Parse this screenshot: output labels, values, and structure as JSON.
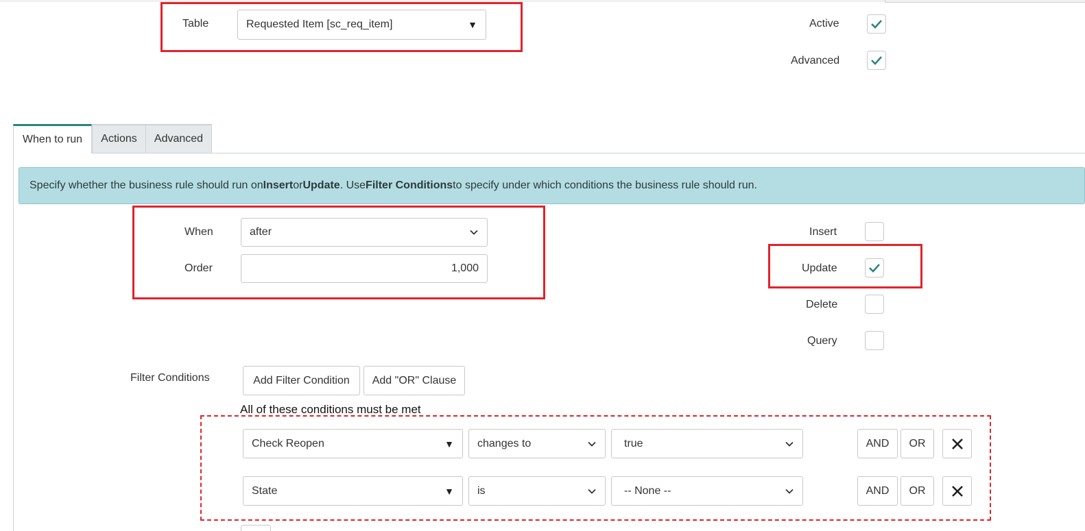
{
  "header": {
    "table_label": "Table",
    "table_value": "Requested Item [sc_req_item]",
    "active_label": "Active",
    "active_checked": true,
    "advanced_label": "Advanced",
    "advanced_checked": true
  },
  "tabs": [
    {
      "label": "When to run",
      "active": true
    },
    {
      "label": "Actions",
      "active": false
    },
    {
      "label": "Advanced",
      "active": false
    }
  ],
  "info": {
    "p1": "Specify whether the business rule should run on ",
    "b1": "Insert",
    "p2": " or ",
    "b2": "Update",
    "p3": ". Use ",
    "b3": "Filter Conditions",
    "p4": " to specify under which conditions the business rule should run."
  },
  "when": {
    "label": "When",
    "value": "after"
  },
  "order": {
    "label": "Order",
    "value": "1,000"
  },
  "operations": {
    "insert_label": "Insert",
    "insert_checked": false,
    "update_label": "Update",
    "update_checked": true,
    "delete_label": "Delete",
    "delete_checked": false,
    "query_label": "Query",
    "query_checked": false
  },
  "filter": {
    "label": "Filter Conditions",
    "add_condition": "Add Filter Condition",
    "add_or": "Add \"OR\" Clause",
    "all_met": "All of these conditions must be met",
    "conditions": [
      {
        "field": "Check Reopen",
        "operator": "changes to",
        "value": "true",
        "and": "AND",
        "or": "OR"
      },
      {
        "field": "State",
        "operator": "is",
        "value": "-- None --",
        "and": "AND",
        "or": "OR"
      }
    ]
  },
  "icons": {
    "dropdown": "triangle-down-icon",
    "chevron": "chevron-down-icon",
    "check": "checkmark-icon",
    "remove": "close-icon"
  },
  "colors": {
    "accent": "#278481",
    "highlight": "#e2222b",
    "info_bg": "#b3dde3"
  }
}
